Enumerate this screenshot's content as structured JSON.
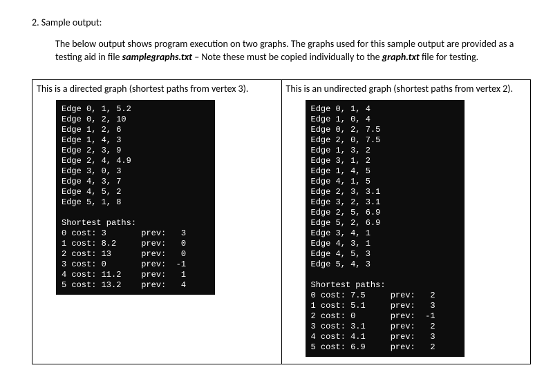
{
  "heading": "2.  Sample output:",
  "intro_part1": "The below output shows program execution on two graphs.  The graphs used for this sample output are provided as a testing aid in file ",
  "intro_file1": "samplegraphs.txt",
  "intro_part2": " – Note these must be copied individually to the ",
  "intro_file2": "graph.txt",
  "intro_part3": " file for testing.",
  "left": {
    "caption": "This is a directed graph (shortest paths from vertex 3).",
    "terminal": "Edge 0, 1, 5.2\nEdge 0, 2, 10\nEdge 1, 2, 6\nEdge 1, 4, 3\nEdge 2, 3, 9\nEdge 2, 4, 4.9\nEdge 3, 0, 3\nEdge 4, 3, 7\nEdge 4, 5, 2\nEdge 5, 1, 8\n\nShortest paths:\n0 cost: 3       prev:   3\n1 cost: 8.2     prev:   0\n2 cost: 13      prev:   0\n3 cost: 0       prev:  -1\n4 cost: 11.2    prev:   1\n5 cost: 13.2    prev:   4"
  },
  "right": {
    "caption": "This is an undirected graph (shortest paths from vertex 2).",
    "terminal": "Edge 0, 1, 4\nEdge 1, 0, 4\nEdge 0, 2, 7.5\nEdge 2, 0, 7.5\nEdge 1, 3, 2\nEdge 3, 1, 2\nEdge 1, 4, 5\nEdge 4, 1, 5\nEdge 2, 3, 3.1\nEdge 3, 2, 3.1\nEdge 2, 5, 6.9\nEdge 5, 2, 6.9\nEdge 3, 4, 1\nEdge 4, 3, 1\nEdge 4, 5, 3\nEdge 5, 4, 3\n\nShortest paths:\n0 cost: 7.5     prev:   2\n1 cost: 5.1     prev:   3\n2 cost: 0       prev:  -1\n3 cost: 3.1     prev:   2\n4 cost: 4.1     prev:   3\n5 cost: 6.9     prev:   2"
  }
}
